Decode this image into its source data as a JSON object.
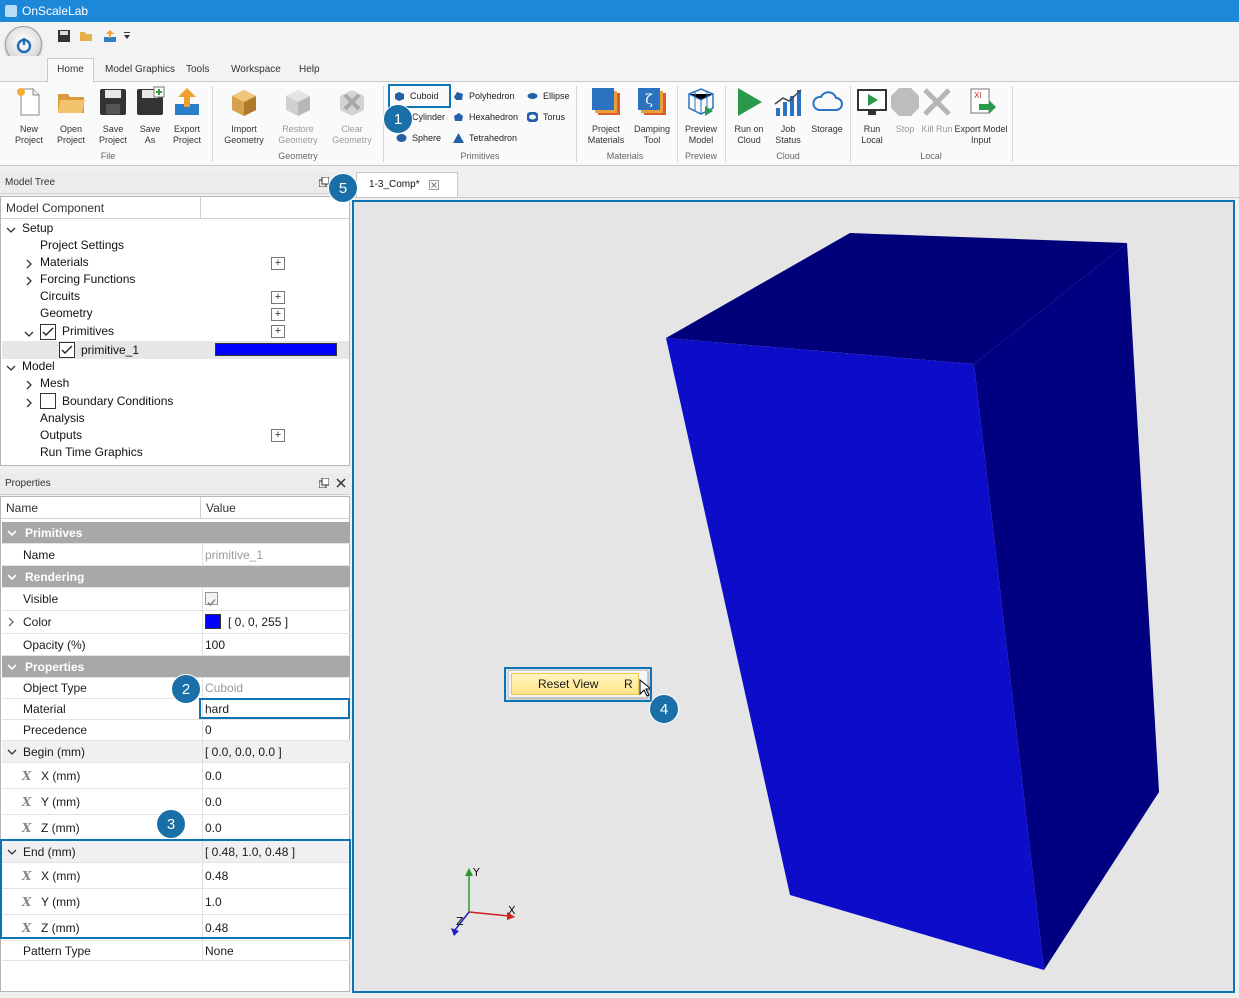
{
  "window": {
    "title": "OnScaleLab"
  },
  "ribbon": {
    "tabs": [
      "Home",
      "Model Graphics",
      "Tools",
      "Workspace",
      "Help"
    ],
    "active_tab": "Home",
    "file": {
      "group": "File",
      "new1": "New",
      "new2": "Project",
      "open1": "Open",
      "open2": "Project",
      "save1": "Save",
      "save2": "Project",
      "saveas1": "Save",
      "saveas2": "As",
      "export1": "Export",
      "export2": "Project"
    },
    "geometry": {
      "group": "Geometry",
      "import1": "Import",
      "import2": "Geometry",
      "restore1": "Restore",
      "restore2": "Geometry",
      "clear1": "Clear",
      "clear2": "Geometry"
    },
    "primitives": {
      "group": "Primitives",
      "cuboid": "Cuboid",
      "cylinder": "Cylinder",
      "sphere": "Sphere",
      "polyhedron": "Polyhedron",
      "hexahedron": "Hexahedron",
      "tetrahedron": "Tetrahedron",
      "ellipse": "Ellipse",
      "torus": "Torus"
    },
    "materials": {
      "group": "Materials",
      "pm1": "Project",
      "pm2": "Materials",
      "dt1": "Damping",
      "dt2": "Tool"
    },
    "preview": {
      "group": "Preview",
      "p1": "Preview",
      "p2": "Model"
    },
    "cloud": {
      "group": "Cloud",
      "run1": "Run on",
      "run2": "Cloud",
      "job1": "Job",
      "job2": "Status",
      "storage": "Storage"
    },
    "local": {
      "group": "Local",
      "run1": "Run",
      "run2": "Local",
      "stop": "Stop",
      "kill": "Kill Run",
      "exp1": "Export Model",
      "exp2": "Input"
    }
  },
  "model_tree": {
    "title": "Model Tree",
    "column": "Model Component",
    "items": [
      "Setup",
      "Project Settings",
      "Materials",
      "Forcing Functions",
      "Circuits",
      "Geometry",
      "Primitives",
      "primitive_1",
      "Model",
      "Mesh",
      "Boundary Conditions",
      "Analysis",
      "Outputs",
      "Run Time Graphics"
    ],
    "primitive_color": "#0000ff"
  },
  "properties": {
    "title": "Properties",
    "col_name": "Name",
    "col_value": "Value",
    "cat_primitives": "Primitives",
    "cat_rendering": "Rendering",
    "cat_properties": "Properties",
    "name_label": "Name",
    "name_value": "primitive_1",
    "visible_label": "Visible",
    "color_label": "Color",
    "color_value": "[ 0, 0, 255 ]",
    "opacity_label": "Opacity (%)",
    "opacity_value": "100",
    "objtype_label": "Object Type",
    "objtype_value": "Cuboid",
    "material_label": "Material",
    "material_value": "hard",
    "precedence_label": "Precedence",
    "precedence_value": "0",
    "begin_label": "Begin (mm)",
    "begin_value": "[ 0.0, 0.0, 0.0 ]",
    "bx_label": "X (mm)",
    "bx_value": "0.0",
    "by_label": "Y (mm)",
    "by_value": "0.0",
    "bz_label": "Z (mm)",
    "bz_value": "0.0",
    "end_label": "End (mm)",
    "end_value": "[ 0.48, 1.0, 0.48 ]",
    "ex_label": "X (mm)",
    "ex_value": "0.48",
    "ey_label": "Y (mm)",
    "ey_value": "1.0",
    "ez_label": "Z (mm)",
    "ez_value": "0.48",
    "pattern_label": "Pattern Type",
    "pattern_value": "None",
    "axis_glyph": "X"
  },
  "document_tab": {
    "label": "1-3_Comp*"
  },
  "context_menu": {
    "item": "Reset View",
    "shortcut": "R"
  },
  "axes": {
    "x": "X",
    "y": "Y",
    "z": "Z"
  },
  "badges": [
    "1",
    "2",
    "3",
    "4",
    "5"
  ],
  "colors": {
    "accent": "#1e88d8",
    "highlight": "#0f72b5",
    "cuboid_front": "#0d0dc9",
    "cuboid_side": "#000080",
    "cuboid_top": "#00007a"
  }
}
